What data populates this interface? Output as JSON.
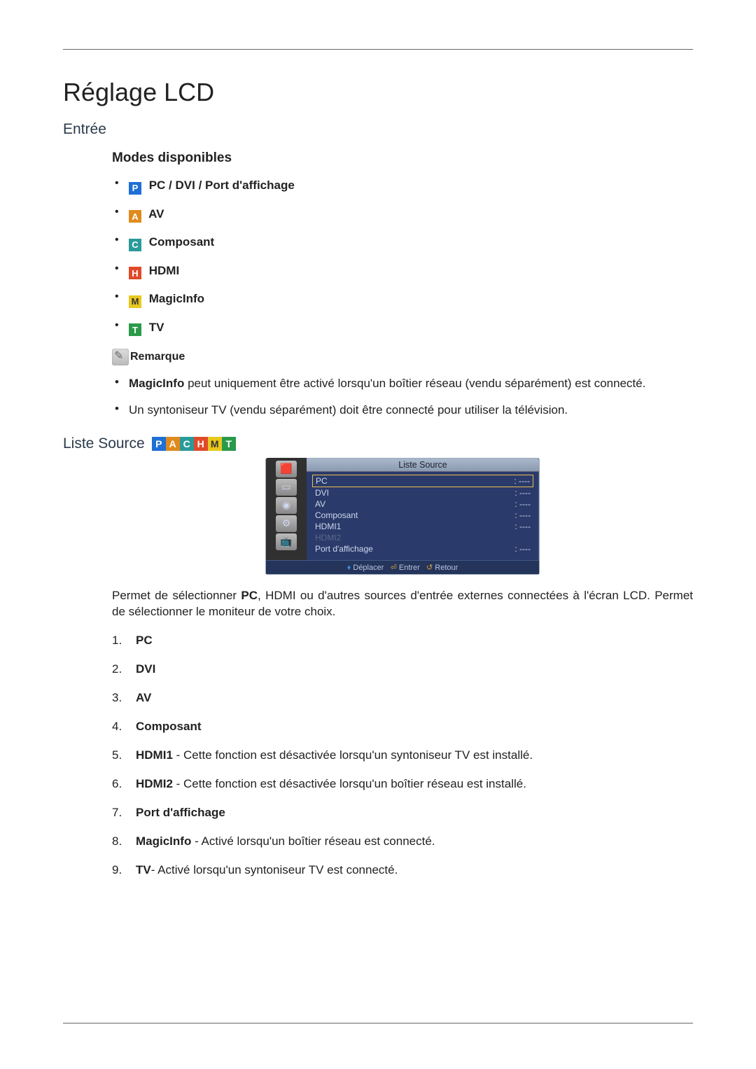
{
  "page_title": "Réglage LCD",
  "section_entree": "Entrée",
  "subheading_modes": "Modes disponibles",
  "modes": [
    {
      "icon": "P",
      "label": " PC / DVI / Port d'affichage"
    },
    {
      "icon": "A",
      "label": " AV"
    },
    {
      "icon": "C",
      "label": " Composant"
    },
    {
      "icon": "H",
      "label": " HDMI"
    },
    {
      "icon": "M",
      "label": " MagicInfo"
    },
    {
      "icon": "T",
      "label": " TV"
    }
  ],
  "note_label": "Remarque",
  "notes": [
    {
      "bold": "MagicInfo",
      "text": " peut uniquement être activé lorsqu'un boîtier réseau (vendu séparément) est connecté."
    },
    {
      "bold": "",
      "text": "Un syntoniseur TV (vendu séparément) doit être connecté pour utiliser la télévision."
    }
  ],
  "liste_source_heading": "Liste Source",
  "icon_strip": [
    "P",
    "A",
    "C",
    "H",
    "M",
    "T"
  ],
  "osd": {
    "title": "Liste Source",
    "rows": [
      {
        "label": "PC",
        "val": ": ----",
        "sel": true
      },
      {
        "label": "DVI",
        "val": ": ----"
      },
      {
        "label": "AV",
        "val": ": ----"
      },
      {
        "label": "Composant",
        "val": ": ----"
      },
      {
        "label": "HDMI1",
        "val": ": ----"
      },
      {
        "label": "HDMI2",
        "val": "",
        "dim": true
      },
      {
        "label": "Port d'affichage",
        "val": ": ----"
      }
    ],
    "footer_move": "Déplacer",
    "footer_enter": "Entrer",
    "footer_return": "Retour"
  },
  "desc_pre": "Permet de sélectionner ",
  "desc_bold": "PC",
  "desc_post": ", HDMI ou d'autres sources d'entrée externes connectées à l'écran LCD. Permet de sélectionner le moniteur de votre choix.",
  "numlist": [
    {
      "bold": "PC",
      "rest": ""
    },
    {
      "bold": "DVI",
      "rest": ""
    },
    {
      "bold": "AV",
      "rest": ""
    },
    {
      "bold": "Composant",
      "rest": ""
    },
    {
      "bold": "HDMI1",
      "rest": " - Cette fonction est désactivée lorsqu'un syntoniseur TV est installé."
    },
    {
      "bold": "HDMI2",
      "rest": " - Cette fonction est désactivée lorsqu'un boîtier réseau est installé."
    },
    {
      "bold": "Port d'affichage",
      "rest": ""
    },
    {
      "bold": "MagicInfo",
      "rest": " - Activé lorsqu'un boîtier réseau est connecté."
    },
    {
      "bold": "TV",
      "rest": "- Activé lorsqu'un syntoniseur TV est connecté."
    }
  ]
}
